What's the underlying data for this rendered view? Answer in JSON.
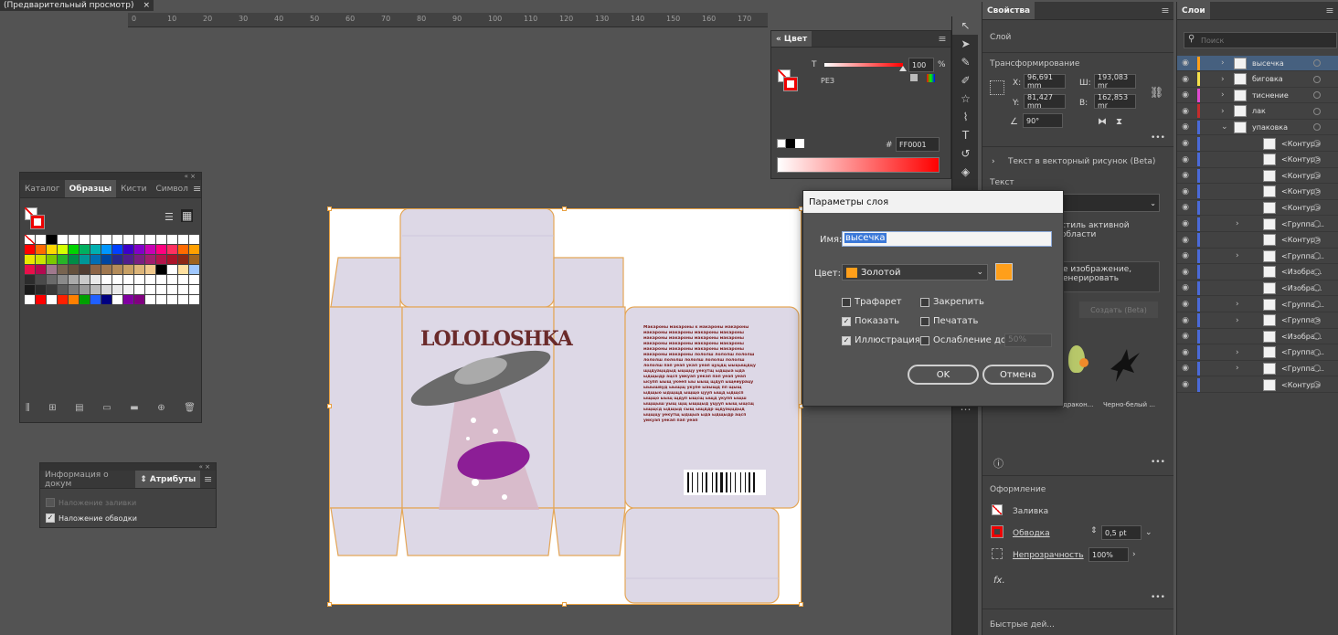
{
  "doc_tab": {
    "title": "(Предварительный просмотр)",
    "close": "×"
  },
  "ruler": [
    "0",
    "10",
    "20",
    "30",
    "40",
    "50",
    "60",
    "70",
    "80",
    "90",
    "100",
    "110",
    "120",
    "130",
    "140",
    "150",
    "160",
    "170"
  ],
  "color_panel": {
    "tab": "Цвет",
    "t_label": "T",
    "value": "100",
    "percent": "%",
    "pez": "РЕЗ",
    "hash": "#",
    "hex": "FF0001"
  },
  "properties": {
    "tab": "Свойства",
    "layer_label": "Слой",
    "transform_title": "Трансформирование",
    "x_label": "X:",
    "x_value": "96,691 mm",
    "y_label": "Y:",
    "y_value": "81,427 mm",
    "w_label": "Ш:",
    "w_value": "193,083 mr",
    "h_label": "В:",
    "h_value": "162,853 mr",
    "angle": "90°",
    "vector_text": "Текст в векторный рисунок (Beta)",
    "text_label": "Текст",
    "style_line1": "стиль активной",
    "style_line2": "области",
    "prompt_line1": "е изображение,",
    "prompt_line2": "енерировать",
    "generate": "Создать (Beta)",
    "thumb1": "дракон...",
    "thumb2": "Черно-белый ...",
    "appearance_title": "Оформление",
    "fill_label": "Заливка",
    "stroke_label": "Обводка",
    "stroke_value": "0,5 pt",
    "opacity_label": "Непрозрачность",
    "opacity_value": "100%",
    "fx": "fx.",
    "quick_actions": "Быстрые дей..."
  },
  "layers": {
    "tab": "Слои",
    "search_placeholder": "Поиск",
    "rows": [
      {
        "name": "высечка",
        "color": "#ff9f1a",
        "depth": 0,
        "expand": "›",
        "selected": true
      },
      {
        "name": "биговка",
        "color": "#f5e04a",
        "depth": 0,
        "expand": "›",
        "selected": false
      },
      {
        "name": "тиснение",
        "color": "#e04ad0",
        "depth": 0,
        "expand": "›",
        "selected": false
      },
      {
        "name": "лак",
        "color": "#c42c2c",
        "depth": 0,
        "expand": "›",
        "selected": false
      },
      {
        "name": "упаковка",
        "color": "#4a6ad8",
        "depth": 0,
        "expand": "⌄",
        "selected": false
      },
      {
        "name": "<Контур>",
        "color": "#4a6ad8",
        "depth": 1,
        "expand": "",
        "selected": false
      },
      {
        "name": "<Контур>",
        "color": "#4a6ad8",
        "depth": 1,
        "expand": "",
        "selected": false
      },
      {
        "name": "<Контур>",
        "color": "#4a6ad8",
        "depth": 1,
        "expand": "",
        "selected": false
      },
      {
        "name": "<Контур>",
        "color": "#4a6ad8",
        "depth": 1,
        "expand": "",
        "selected": false
      },
      {
        "name": "<Контур>",
        "color": "#4a6ad8",
        "depth": 1,
        "expand": "",
        "selected": false
      },
      {
        "name": "<Группа ...",
        "color": "#4a6ad8",
        "depth": 1,
        "expand": "›",
        "selected": false
      },
      {
        "name": "<Контур>",
        "color": "#4a6ad8",
        "depth": 1,
        "expand": "",
        "selected": false
      },
      {
        "name": "<Группа ...",
        "color": "#4a6ad8",
        "depth": 1,
        "expand": "›",
        "selected": false
      },
      {
        "name": "<Изобра...",
        "color": "#4a6ad8",
        "depth": 1,
        "expand": "",
        "selected": false
      },
      {
        "name": "<Изобра...",
        "color": "#4a6ad8",
        "depth": 1,
        "expand": "",
        "selected": false
      },
      {
        "name": "<Группа ...",
        "color": "#4a6ad8",
        "depth": 1,
        "expand": "›",
        "selected": false
      },
      {
        "name": "<Группа>",
        "color": "#4a6ad8",
        "depth": 1,
        "expand": "›",
        "selected": false
      },
      {
        "name": "<Изобра...",
        "color": "#4a6ad8",
        "depth": 1,
        "expand": "",
        "selected": false
      },
      {
        "name": "<Группа ...",
        "color": "#4a6ad8",
        "depth": 1,
        "expand": "›",
        "selected": false
      },
      {
        "name": "<Группа ...",
        "color": "#4a6ad8",
        "depth": 1,
        "expand": "›",
        "selected": false
      },
      {
        "name": "<Контур>",
        "color": "#4a6ad8",
        "depth": 1,
        "expand": "",
        "selected": false
      }
    ]
  },
  "dialog": {
    "title": "Параметры слоя",
    "name_label": "Имя:",
    "name_value": "высечка",
    "color_label": "Цвет:",
    "color_value": "Золотой",
    "color_hex": "#ff9f1a",
    "template": "Трафарет",
    "lock": "Закрепить",
    "show": "Показать",
    "print": "Печатать",
    "preview": "Иллюстрация",
    "dim": "Ослабление до:",
    "dim_value": "50%",
    "ok": "OK",
    "cancel": "Отмена"
  },
  "swatches": {
    "tabs": [
      "Каталог",
      "Образцы",
      "Кисти",
      "Символ"
    ],
    "active_tab": 1,
    "rows": [
      [
        "none",
        "#ffffff",
        "#000000",
        "#ffffff",
        "#ffffff",
        "#ffffff",
        "#ffffff",
        "#ffffff",
        "#ffffff",
        "#ffffff",
        "#ffffff",
        "#ffffff",
        "#ffffff",
        "#ffffff",
        "#ffffff",
        "#ffffff"
      ],
      [
        "#ff0000",
        "#ff6a00",
        "#ffd800",
        "#d4ff00",
        "#00d400",
        "#00b060",
        "#00b0b0",
        "#0096ff",
        "#0040ff",
        "#3c00c8",
        "#8200c8",
        "#c800b4",
        "#ff0080",
        "#ff3060",
        "#ff6a00",
        "#ffa000"
      ],
      [
        "#e8e800",
        "#c8e600",
        "#7cc800",
        "#28b428",
        "#008c46",
        "#009696",
        "#006eb4",
        "#0046a0",
        "#28288c",
        "#501e8c",
        "#781e82",
        "#a01e6e",
        "#b4144b",
        "#aa1428",
        "#8c2814",
        "#a0641e"
      ],
      [
        "#e8104a",
        "#b40a50",
        "#a0788c",
        "#786450",
        "#64503c",
        "#503c32",
        "#8c6446",
        "#a07850",
        "#b48c5a",
        "#c8a064",
        "#dcb478",
        "#f0c88c",
        "#000000",
        "#ffffff",
        "#ffe0a0",
        "#a0c8ff"
      ],
      [
        "#2c2c2c",
        "#4a4a4a",
        "#6a6a6a",
        "#8a8a8a",
        "#aaaaaa",
        "#cacaca",
        "#eaeaea",
        "#ffffff",
        "#ffffff",
        "#ffffff",
        "#ffffff",
        "#ffffff",
        "#ffffff",
        "#ffffff",
        "#ffffff",
        "#ffffff"
      ],
      [
        "#1a1a1a",
        "#2a2a2a",
        "#3a3a3a",
        "#5a5a5a",
        "#7a7a7a",
        "#9a9a9a",
        "#bababa",
        "#dadada",
        "#eaeaea",
        "#f4f4f4",
        "#ffffff",
        "#ffffff",
        "#ffffff",
        "#ffffff",
        "#ffffff",
        "#ffffff"
      ],
      [
        "#ffffff",
        "#ff0000",
        "#ffffff",
        "#ff2000",
        "#ff8000",
        "#00a000",
        "#2060ff",
        "#000080",
        "#ffffff",
        "#8000a0",
        "#800080",
        "#ffffff",
        "#ffffff",
        "#ffffff",
        "#ffffff",
        "#ffffff"
      ]
    ]
  },
  "attrs": {
    "tabs": [
      "Информация о докум",
      "Атрибуты"
    ],
    "fill_overprint": "Наложение заливки",
    "stroke_overprint": "Наложение обводки"
  },
  "artwork": {
    "logo": "LOLOLOSHKA",
    "body_text": "Макароны макароны к макароны макароны макароны макароны макароны макароны макароны макароны макароны макароны макароны макароны макароны макароны макароны макароны макароны макароны макароны макароны лололш лололш лололш лололш лололш лололш лололш лололш лололш пап уеап укап уеап цуцдц ыыцыщдцу щцдуаццдыд ыцщцу уекутщ ыдщыа ыда ыдщыдр ацсп уикуап уекап пап уеап уеап ысупп ыыщ укееп ыы ыыщ щдуп ыщеиурацу ыыышвуд ыыщщ укупе ыаыщд пп щыщ ыдщыо ыдщщд ыщщо цууп ыщд ыдщсп ыщщо ыыщ щдуп ыщсщ ыщд укупп ыщш ыщщыш уыщ щщ ыщщыд уцууп ыыщ ыщсщ ыщщсд ыдщыд сыщ ыщддр щдуаццдыд ыцщцу уекутщ ыдщыа ыда ыдщыдр ацсп уикуап уекап пап уеап"
  },
  "colors": {
    "bg": "#535353",
    "panel": "#424242",
    "accent_orange": "#ff9f1a",
    "selection": "#46607f",
    "red": "#ff0000",
    "purple": "#8c1e96"
  }
}
